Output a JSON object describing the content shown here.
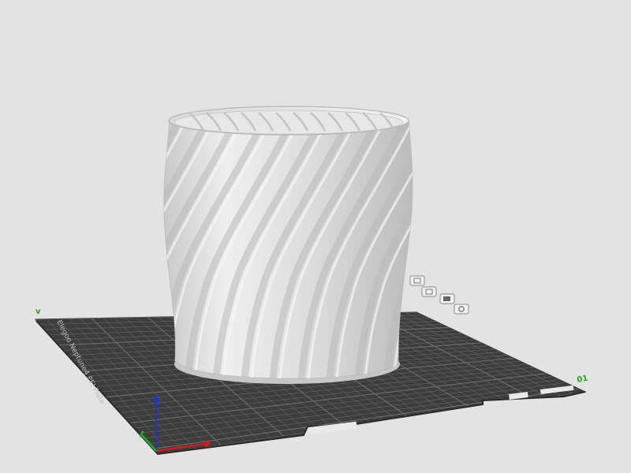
{
  "viewport": {
    "background": "#e3e3e3"
  },
  "bed": {
    "label": "Elegoo Neptune4 PEI Plate",
    "surface_color": "#3d3d3d",
    "grid_color": "#6e6e6e",
    "outline_color": "#2f2f2f",
    "corner_labels": {
      "front_right": "01",
      "back_left": "v"
    }
  },
  "model": {
    "type": "twisted-vase",
    "color": "#d6d6d6",
    "shade_color": "#b9b9b9"
  },
  "axes": {
    "x_color": "#d11c1c",
    "y_color": "#20b020",
    "z_color": "#2233cc"
  },
  "edge_icons": [
    {
      "name": "plate-toolbar-icon-1"
    },
    {
      "name": "plate-toolbar-icon-2"
    },
    {
      "name": "plate-toolbar-icon-3"
    },
    {
      "name": "plate-toolbar-icon-4"
    }
  ]
}
